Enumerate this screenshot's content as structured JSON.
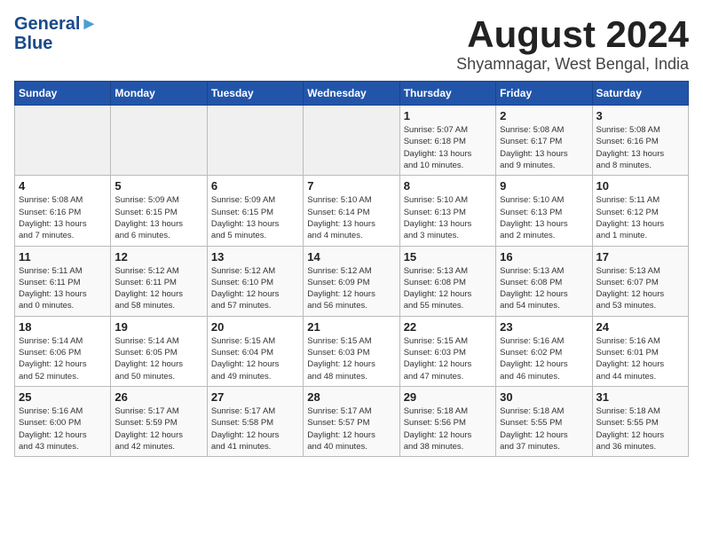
{
  "header": {
    "logo_line1": "General",
    "logo_line2": "Blue",
    "month_year": "August 2024",
    "location": "Shyamnagar, West Bengal, India"
  },
  "days_of_week": [
    "Sunday",
    "Monday",
    "Tuesday",
    "Wednesday",
    "Thursday",
    "Friday",
    "Saturday"
  ],
  "weeks": [
    [
      {
        "day": "",
        "info": ""
      },
      {
        "day": "",
        "info": ""
      },
      {
        "day": "",
        "info": ""
      },
      {
        "day": "",
        "info": ""
      },
      {
        "day": "1",
        "info": "Sunrise: 5:07 AM\nSunset: 6:18 PM\nDaylight: 13 hours\nand 10 minutes."
      },
      {
        "day": "2",
        "info": "Sunrise: 5:08 AM\nSunset: 6:17 PM\nDaylight: 13 hours\nand 9 minutes."
      },
      {
        "day": "3",
        "info": "Sunrise: 5:08 AM\nSunset: 6:16 PM\nDaylight: 13 hours\nand 8 minutes."
      }
    ],
    [
      {
        "day": "4",
        "info": "Sunrise: 5:08 AM\nSunset: 6:16 PM\nDaylight: 13 hours\nand 7 minutes."
      },
      {
        "day": "5",
        "info": "Sunrise: 5:09 AM\nSunset: 6:15 PM\nDaylight: 13 hours\nand 6 minutes."
      },
      {
        "day": "6",
        "info": "Sunrise: 5:09 AM\nSunset: 6:15 PM\nDaylight: 13 hours\nand 5 minutes."
      },
      {
        "day": "7",
        "info": "Sunrise: 5:10 AM\nSunset: 6:14 PM\nDaylight: 13 hours\nand 4 minutes."
      },
      {
        "day": "8",
        "info": "Sunrise: 5:10 AM\nSunset: 6:13 PM\nDaylight: 13 hours\nand 3 minutes."
      },
      {
        "day": "9",
        "info": "Sunrise: 5:10 AM\nSunset: 6:13 PM\nDaylight: 13 hours\nand 2 minutes."
      },
      {
        "day": "10",
        "info": "Sunrise: 5:11 AM\nSunset: 6:12 PM\nDaylight: 13 hours\nand 1 minute."
      }
    ],
    [
      {
        "day": "11",
        "info": "Sunrise: 5:11 AM\nSunset: 6:11 PM\nDaylight: 13 hours\nand 0 minutes."
      },
      {
        "day": "12",
        "info": "Sunrise: 5:12 AM\nSunset: 6:11 PM\nDaylight: 12 hours\nand 58 minutes."
      },
      {
        "day": "13",
        "info": "Sunrise: 5:12 AM\nSunset: 6:10 PM\nDaylight: 12 hours\nand 57 minutes."
      },
      {
        "day": "14",
        "info": "Sunrise: 5:12 AM\nSunset: 6:09 PM\nDaylight: 12 hours\nand 56 minutes."
      },
      {
        "day": "15",
        "info": "Sunrise: 5:13 AM\nSunset: 6:08 PM\nDaylight: 12 hours\nand 55 minutes."
      },
      {
        "day": "16",
        "info": "Sunrise: 5:13 AM\nSunset: 6:08 PM\nDaylight: 12 hours\nand 54 minutes."
      },
      {
        "day": "17",
        "info": "Sunrise: 5:13 AM\nSunset: 6:07 PM\nDaylight: 12 hours\nand 53 minutes."
      }
    ],
    [
      {
        "day": "18",
        "info": "Sunrise: 5:14 AM\nSunset: 6:06 PM\nDaylight: 12 hours\nand 52 minutes."
      },
      {
        "day": "19",
        "info": "Sunrise: 5:14 AM\nSunset: 6:05 PM\nDaylight: 12 hours\nand 50 minutes."
      },
      {
        "day": "20",
        "info": "Sunrise: 5:15 AM\nSunset: 6:04 PM\nDaylight: 12 hours\nand 49 minutes."
      },
      {
        "day": "21",
        "info": "Sunrise: 5:15 AM\nSunset: 6:03 PM\nDaylight: 12 hours\nand 48 minutes."
      },
      {
        "day": "22",
        "info": "Sunrise: 5:15 AM\nSunset: 6:03 PM\nDaylight: 12 hours\nand 47 minutes."
      },
      {
        "day": "23",
        "info": "Sunrise: 5:16 AM\nSunset: 6:02 PM\nDaylight: 12 hours\nand 46 minutes."
      },
      {
        "day": "24",
        "info": "Sunrise: 5:16 AM\nSunset: 6:01 PM\nDaylight: 12 hours\nand 44 minutes."
      }
    ],
    [
      {
        "day": "25",
        "info": "Sunrise: 5:16 AM\nSunset: 6:00 PM\nDaylight: 12 hours\nand 43 minutes."
      },
      {
        "day": "26",
        "info": "Sunrise: 5:17 AM\nSunset: 5:59 PM\nDaylight: 12 hours\nand 42 minutes."
      },
      {
        "day": "27",
        "info": "Sunrise: 5:17 AM\nSunset: 5:58 PM\nDaylight: 12 hours\nand 41 minutes."
      },
      {
        "day": "28",
        "info": "Sunrise: 5:17 AM\nSunset: 5:57 PM\nDaylight: 12 hours\nand 40 minutes."
      },
      {
        "day": "29",
        "info": "Sunrise: 5:18 AM\nSunset: 5:56 PM\nDaylight: 12 hours\nand 38 minutes."
      },
      {
        "day": "30",
        "info": "Sunrise: 5:18 AM\nSunset: 5:55 PM\nDaylight: 12 hours\nand 37 minutes."
      },
      {
        "day": "31",
        "info": "Sunrise: 5:18 AM\nSunset: 5:55 PM\nDaylight: 12 hours\nand 36 minutes."
      }
    ]
  ]
}
